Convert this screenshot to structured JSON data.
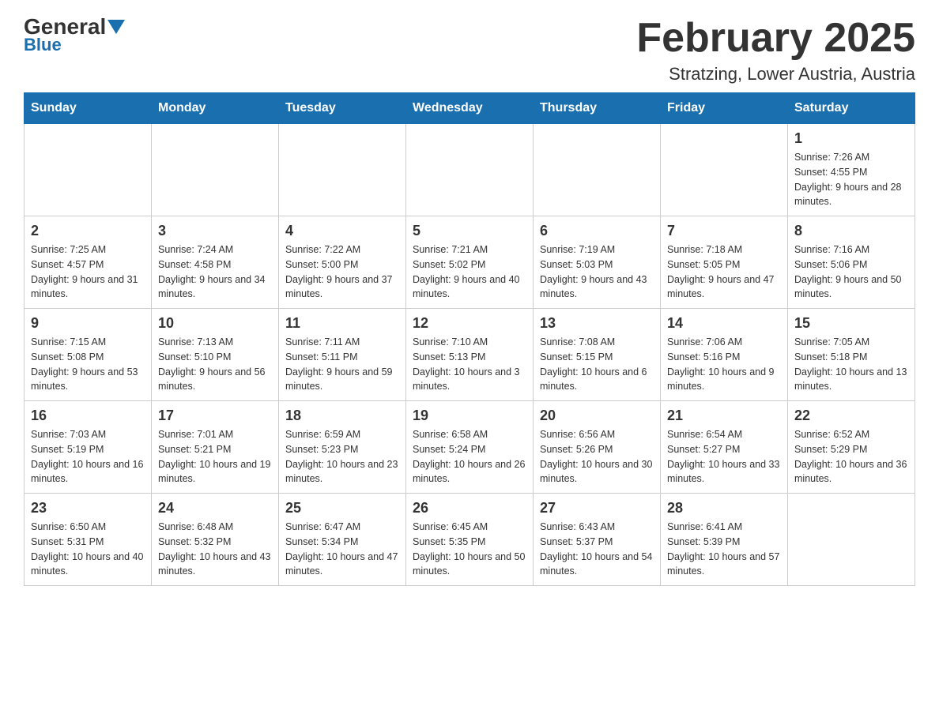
{
  "header": {
    "logo_general": "General",
    "logo_blue": "Blue",
    "month_title": "February 2025",
    "location": "Stratzing, Lower Austria, Austria"
  },
  "days_of_week": [
    "Sunday",
    "Monday",
    "Tuesday",
    "Wednesday",
    "Thursday",
    "Friday",
    "Saturday"
  ],
  "weeks": [
    [
      {
        "day": "",
        "info": ""
      },
      {
        "day": "",
        "info": ""
      },
      {
        "day": "",
        "info": ""
      },
      {
        "day": "",
        "info": ""
      },
      {
        "day": "",
        "info": ""
      },
      {
        "day": "",
        "info": ""
      },
      {
        "day": "1",
        "info": "Sunrise: 7:26 AM\nSunset: 4:55 PM\nDaylight: 9 hours and 28 minutes."
      }
    ],
    [
      {
        "day": "2",
        "info": "Sunrise: 7:25 AM\nSunset: 4:57 PM\nDaylight: 9 hours and 31 minutes."
      },
      {
        "day": "3",
        "info": "Sunrise: 7:24 AM\nSunset: 4:58 PM\nDaylight: 9 hours and 34 minutes."
      },
      {
        "day": "4",
        "info": "Sunrise: 7:22 AM\nSunset: 5:00 PM\nDaylight: 9 hours and 37 minutes."
      },
      {
        "day": "5",
        "info": "Sunrise: 7:21 AM\nSunset: 5:02 PM\nDaylight: 9 hours and 40 minutes."
      },
      {
        "day": "6",
        "info": "Sunrise: 7:19 AM\nSunset: 5:03 PM\nDaylight: 9 hours and 43 minutes."
      },
      {
        "day": "7",
        "info": "Sunrise: 7:18 AM\nSunset: 5:05 PM\nDaylight: 9 hours and 47 minutes."
      },
      {
        "day": "8",
        "info": "Sunrise: 7:16 AM\nSunset: 5:06 PM\nDaylight: 9 hours and 50 minutes."
      }
    ],
    [
      {
        "day": "9",
        "info": "Sunrise: 7:15 AM\nSunset: 5:08 PM\nDaylight: 9 hours and 53 minutes."
      },
      {
        "day": "10",
        "info": "Sunrise: 7:13 AM\nSunset: 5:10 PM\nDaylight: 9 hours and 56 minutes."
      },
      {
        "day": "11",
        "info": "Sunrise: 7:11 AM\nSunset: 5:11 PM\nDaylight: 9 hours and 59 minutes."
      },
      {
        "day": "12",
        "info": "Sunrise: 7:10 AM\nSunset: 5:13 PM\nDaylight: 10 hours and 3 minutes."
      },
      {
        "day": "13",
        "info": "Sunrise: 7:08 AM\nSunset: 5:15 PM\nDaylight: 10 hours and 6 minutes."
      },
      {
        "day": "14",
        "info": "Sunrise: 7:06 AM\nSunset: 5:16 PM\nDaylight: 10 hours and 9 minutes."
      },
      {
        "day": "15",
        "info": "Sunrise: 7:05 AM\nSunset: 5:18 PM\nDaylight: 10 hours and 13 minutes."
      }
    ],
    [
      {
        "day": "16",
        "info": "Sunrise: 7:03 AM\nSunset: 5:19 PM\nDaylight: 10 hours and 16 minutes."
      },
      {
        "day": "17",
        "info": "Sunrise: 7:01 AM\nSunset: 5:21 PM\nDaylight: 10 hours and 19 minutes."
      },
      {
        "day": "18",
        "info": "Sunrise: 6:59 AM\nSunset: 5:23 PM\nDaylight: 10 hours and 23 minutes."
      },
      {
        "day": "19",
        "info": "Sunrise: 6:58 AM\nSunset: 5:24 PM\nDaylight: 10 hours and 26 minutes."
      },
      {
        "day": "20",
        "info": "Sunrise: 6:56 AM\nSunset: 5:26 PM\nDaylight: 10 hours and 30 minutes."
      },
      {
        "day": "21",
        "info": "Sunrise: 6:54 AM\nSunset: 5:27 PM\nDaylight: 10 hours and 33 minutes."
      },
      {
        "day": "22",
        "info": "Sunrise: 6:52 AM\nSunset: 5:29 PM\nDaylight: 10 hours and 36 minutes."
      }
    ],
    [
      {
        "day": "23",
        "info": "Sunrise: 6:50 AM\nSunset: 5:31 PM\nDaylight: 10 hours and 40 minutes."
      },
      {
        "day": "24",
        "info": "Sunrise: 6:48 AM\nSunset: 5:32 PM\nDaylight: 10 hours and 43 minutes."
      },
      {
        "day": "25",
        "info": "Sunrise: 6:47 AM\nSunset: 5:34 PM\nDaylight: 10 hours and 47 minutes."
      },
      {
        "day": "26",
        "info": "Sunrise: 6:45 AM\nSunset: 5:35 PM\nDaylight: 10 hours and 50 minutes."
      },
      {
        "day": "27",
        "info": "Sunrise: 6:43 AM\nSunset: 5:37 PM\nDaylight: 10 hours and 54 minutes."
      },
      {
        "day": "28",
        "info": "Sunrise: 6:41 AM\nSunset: 5:39 PM\nDaylight: 10 hours and 57 minutes."
      },
      {
        "day": "",
        "info": ""
      }
    ]
  ]
}
